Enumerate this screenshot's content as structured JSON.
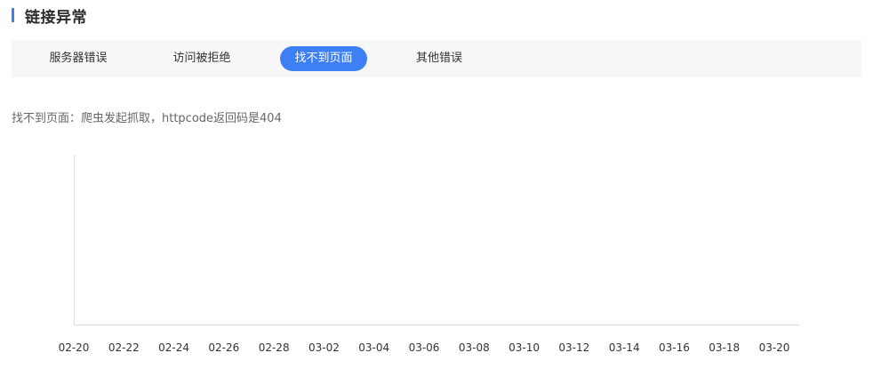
{
  "section": {
    "title": "链接异常"
  },
  "tabs": [
    {
      "label": "服务器错误",
      "active": false
    },
    {
      "label": "访问被拒绝",
      "active": false
    },
    {
      "label": "找不到页面",
      "active": true
    },
    {
      "label": "其他错误",
      "active": false
    }
  ],
  "description": "找不到页面：爬虫发起抓取，httpcode返回码是404",
  "colors": {
    "accent": "#3d7ff4",
    "tab_bar_bg": "#f7f7f7",
    "axis": "#dddddd"
  },
  "chart_data": {
    "type": "line",
    "title": "",
    "xlabel": "",
    "ylabel": "",
    "grid": false,
    "x": [
      "02-20",
      "02-22",
      "02-24",
      "02-26",
      "02-28",
      "03-02",
      "03-04",
      "03-06",
      "03-08",
      "03-10",
      "03-12",
      "03-14",
      "03-16",
      "03-18",
      "03-20"
    ],
    "series": []
  }
}
